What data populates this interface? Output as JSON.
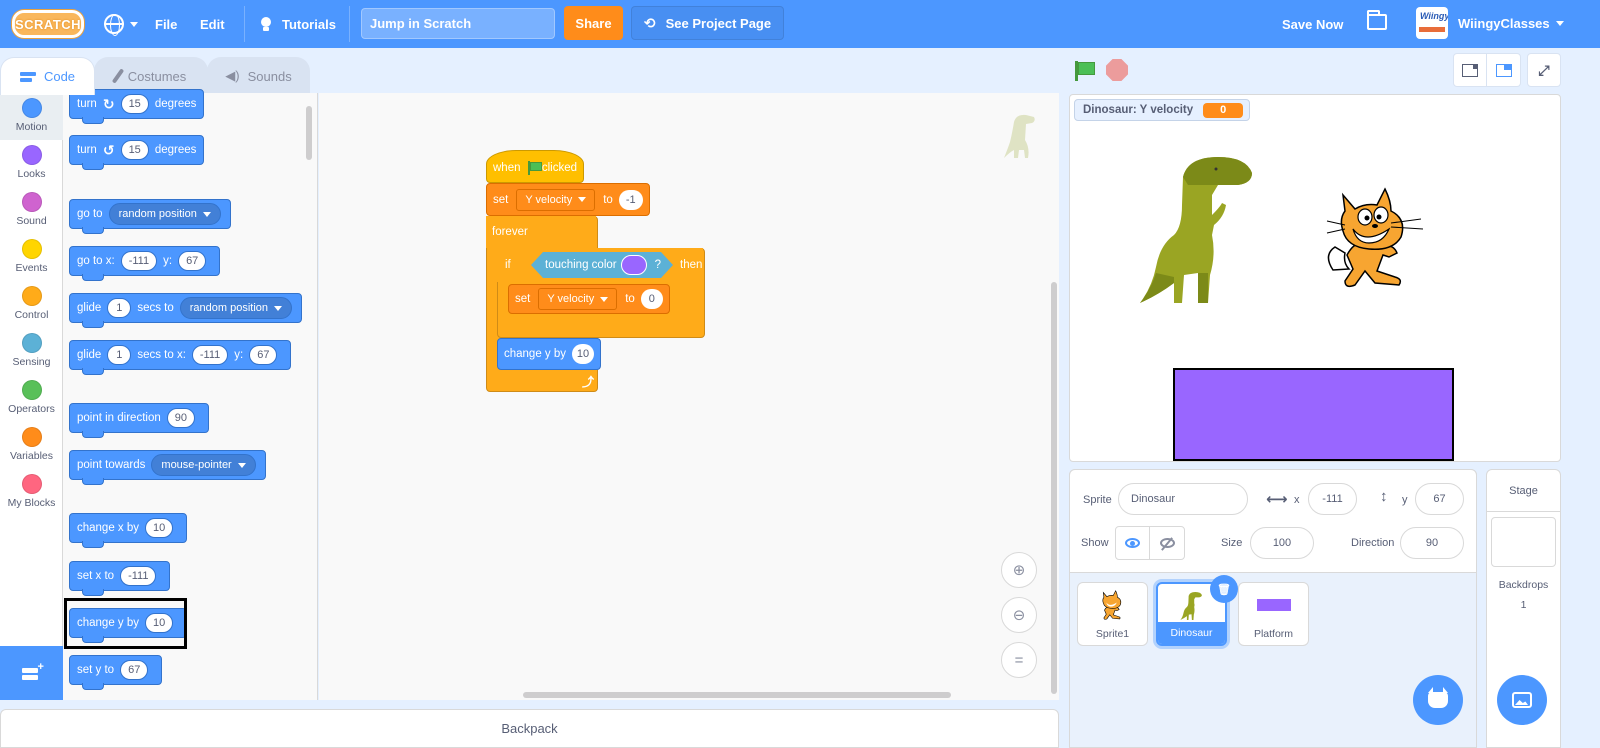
{
  "menubar": {
    "logo": "SCRATCH",
    "file": "File",
    "edit": "Edit",
    "tutorials": "Tutorials",
    "project_title": "Jump in Scratch",
    "share": "Share",
    "see_project_page": "See Project Page",
    "save_now": "Save Now",
    "account_logo": "Wiingy",
    "username": "WiingyClasses"
  },
  "tabs": [
    {
      "label": "Code",
      "active": true
    },
    {
      "label": "Costumes",
      "active": false
    },
    {
      "label": "Sounds",
      "active": false
    }
  ],
  "categories": [
    {
      "label": "Motion",
      "color": "#4c97ff",
      "selected": true
    },
    {
      "label": "Looks",
      "color": "#9966ff"
    },
    {
      "label": "Sound",
      "color": "#cf63cf"
    },
    {
      "label": "Events",
      "color": "#ffd500"
    },
    {
      "label": "Control",
      "color": "#ffab19"
    },
    {
      "label": "Sensing",
      "color": "#5cb1d6"
    },
    {
      "label": "Operators",
      "color": "#59c059"
    },
    {
      "label": "Variables",
      "color": "#ff8c1a"
    },
    {
      "label": "My Blocks",
      "color": "#ff6680"
    }
  ],
  "palette": {
    "turn_right": {
      "w1": "turn",
      "val": "15",
      "w2": "degrees"
    },
    "turn_left": {
      "w1": "turn",
      "val": "15",
      "w2": "degrees"
    },
    "go_to": {
      "w1": "go to",
      "menu": "random position"
    },
    "go_to_xy": {
      "w1": "go to x:",
      "x": "-111",
      "w2": "y:",
      "y": "67"
    },
    "glide_to": {
      "w1": "glide",
      "secs": "1",
      "w2": "secs to",
      "menu": "random position"
    },
    "glide_xy": {
      "w1": "glide",
      "secs": "1",
      "w2": "secs to x:",
      "x": "-111",
      "w3": "y:",
      "y": "67"
    },
    "point_dir": {
      "w1": "point in direction",
      "val": "90"
    },
    "point_towards": {
      "w1": "point towards",
      "menu": "mouse-pointer"
    },
    "change_x": {
      "w1": "change x by",
      "val": "10"
    },
    "set_x": {
      "w1": "set x to",
      "val": "-111"
    },
    "change_y": {
      "w1": "change y by",
      "val": "10"
    },
    "set_y": {
      "w1": "set y to",
      "val": "67"
    }
  },
  "script": {
    "hat": {
      "w1": "when",
      "w2": "clicked"
    },
    "set1": {
      "w1": "set",
      "var": "Y velocity",
      "w2": "to",
      "val": "-1"
    },
    "forever": "forever",
    "if": {
      "w1": "if",
      "cond": "touching color",
      "q": "?",
      "w2": "then",
      "color": "#9966ff"
    },
    "set2": {
      "w1": "set",
      "var": "Y velocity",
      "w2": "to",
      "val": "0"
    },
    "change_y": {
      "w1": "change y by",
      "val": "10"
    }
  },
  "backpack": "Backpack",
  "stage": {
    "monitor_label": "Dinosaur: Y velocity",
    "monitor_value": "0"
  },
  "sprite_info": {
    "sprite_label": "Sprite",
    "sprite_name": "Dinosaur",
    "x_label": "x",
    "x": "-111",
    "y_label": "y",
    "y": "67",
    "show_label": "Show",
    "size_label": "Size",
    "size": "100",
    "direction_label": "Direction",
    "direction": "90"
  },
  "sprites": [
    {
      "name": "Sprite1"
    },
    {
      "name": "Dinosaur",
      "selected": true
    },
    {
      "name": "Platform"
    }
  ],
  "stage_pane": {
    "title": "Stage",
    "backdrops_label": "Backdrops",
    "backdrops_count": "1"
  }
}
